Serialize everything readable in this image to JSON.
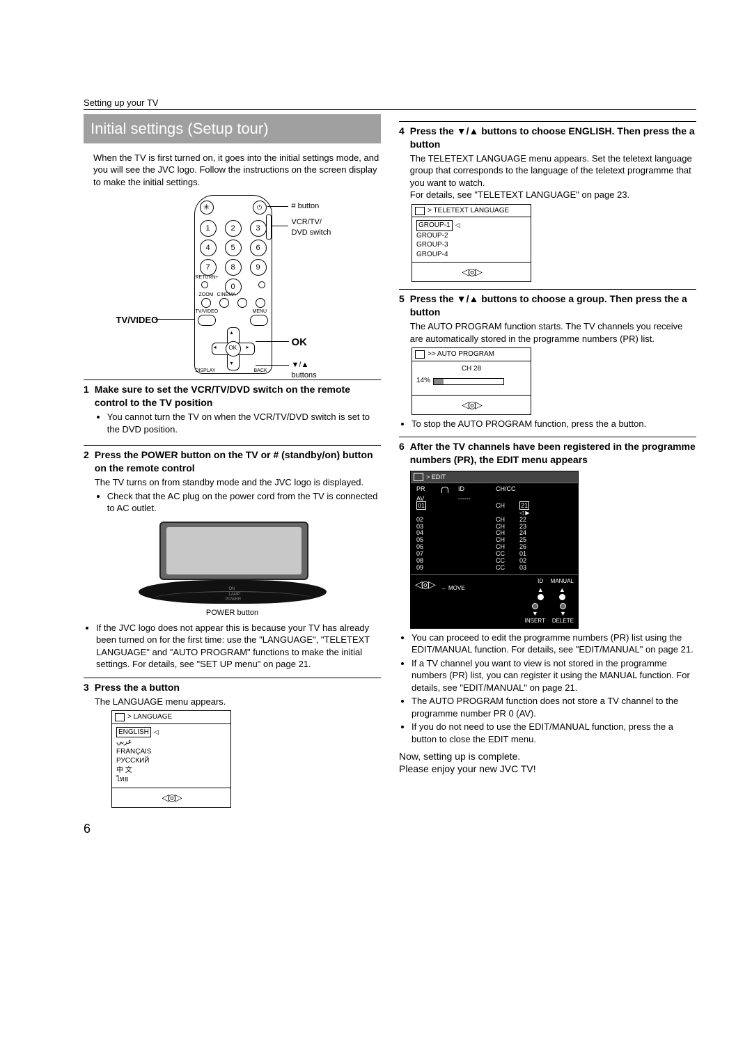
{
  "page_number": "6",
  "section_label": "Setting up your TV",
  "heading": "Initial settings (Setup tour)",
  "intro": "When the TV is first turned on, it goes into the initial settings mode, and you will see the JVC logo. Follow the instructions on the screen display to make the initial settings.",
  "remote": {
    "label_tvvideo": "TV/VIDEO",
    "label_ok": "OK",
    "callout_standby": "# button",
    "callout_switch": "VCR/TV/\nDVD switch",
    "callout_arrows": "▼/▲ buttons",
    "tiny_return": "RETURN+",
    "tiny_zoom": "ZOOM",
    "tiny_cinema": "CINEMA",
    "tiny_tvvideo": "TV/VIDEO",
    "tiny_menu": "MENU",
    "tiny_display": "DISPLAY",
    "tiny_back": "BACK",
    "ok_inner": "OK"
  },
  "steps_left": [
    {
      "num": "1",
      "title": "Make sure to set the VCR/TV/DVD switch on the remote control to the TV position",
      "bullets": [
        "You cannot turn the TV on when the VCR/TV/DVD switch is set to the DVD position."
      ]
    },
    {
      "num": "2",
      "title": "Press the POWER button on the TV or # (standby/on) button on the remote control",
      "text": "The TV turns on from standby mode and the JVC logo is displayed.",
      "bullets": [
        "Check that the AC plug on the power cord from the TV is connected to AC outlet."
      ]
    },
    {
      "num": "3",
      "title": "Press the a button",
      "text": "The LANGUAGE menu appears."
    }
  ],
  "tv_caption": "POWER button",
  "post_tv_bullets": [
    "If the JVC logo does not appear this is because your TV has already been turned on for the first time: use the \"LANGUAGE\", \"TELETEXT LANGUAGE\" and \"AUTO PROGRAM\" functions to make the initial settings. For details, see \"SET UP menu\" on page 21."
  ],
  "osd_language": {
    "title": "> LANGUAGE",
    "items": [
      "ENGLISH",
      "عربي",
      "FRANÇAIS",
      "РУССКИЙ",
      "中 文",
      "ไทย"
    ]
  },
  "steps_right": [
    {
      "num": "4",
      "title": "Press the ▼/▲ buttons to choose ENGLISH. Then press the a button",
      "text": "The TELETEXT LANGUAGE menu appears. Set the teletext language group that corresponds to the language of the teletext programme that you want to watch.\nFor details, see \"TELETEXT LANGUAGE\" on page 23."
    },
    {
      "num": "5",
      "title": "Press the ▼/▲ buttons to choose a group. Then press the a button",
      "text": "The AUTO PROGRAM function starts. The TV channels you receive are automatically stored in the programme numbers (PR) list."
    },
    {
      "num": "6",
      "title": "After the TV channels have been registered in the programme numbers (PR), the EDIT menu appears"
    }
  ],
  "osd_teletext": {
    "title": "> TELETEXT LANGUAGE",
    "items": [
      "GROUP-1",
      "GROUP-2",
      "GROUP-3",
      "GROUP-4"
    ]
  },
  "osd_autoprogram": {
    "title": ">> AUTO PROGRAM",
    "ch_label": "CH  28",
    "percent": "14%"
  },
  "post_autoprogram_bullets": [
    "To stop the AUTO PROGRAM function, press the a button."
  ],
  "osd_edit": {
    "title": "> EDIT",
    "col_pr": "PR",
    "col_lock": "🔒",
    "col_id": "ID",
    "col_chcc": "CH/CC",
    "rows": [
      {
        "pr": "AV",
        "id": "------",
        "cc": "",
        "ch": ""
      },
      {
        "pr": "01",
        "id": "",
        "cc": "CH",
        "ch": "21",
        "sel": true
      },
      {
        "pr": "02",
        "id": "",
        "cc": "CH",
        "ch": "22"
      },
      {
        "pr": "03",
        "id": "",
        "cc": "CH",
        "ch": "23"
      },
      {
        "pr": "04",
        "id": "",
        "cc": "CH",
        "ch": "24"
      },
      {
        "pr": "05",
        "id": "",
        "cc": "CH",
        "ch": "25"
      },
      {
        "pr": "06",
        "id": "",
        "cc": "CH",
        "ch": "26"
      },
      {
        "pr": "07",
        "id": "",
        "cc": "CC",
        "ch": "01"
      },
      {
        "pr": "08",
        "id": "",
        "cc": "CC",
        "ch": "02"
      },
      {
        "pr": "09",
        "id": "",
        "cc": "CC",
        "ch": "03"
      }
    ],
    "footer_move": "MOVE",
    "footer_id": "ID",
    "footer_manual": "MANUAL",
    "footer_insert": "INSERT",
    "footer_delete": "DELETE"
  },
  "post_edit_bullets": [
    "You can proceed to edit the programme numbers (PR) list using the EDIT/MANUAL function. For details, see \"EDIT/MANUAL\" on page 21.",
    "If a TV channel you want to view is not stored in the programme numbers (PR) list, you can register it using the MANUAL function. For details, see \"EDIT/MANUAL\" on page 21.",
    "The AUTO PROGRAM function does not store a TV channel to the programme number PR 0 (AV).",
    "If you do not need to use the EDIT/MANUAL function, press the a button to close the EDIT menu."
  ],
  "closing1": "Now, setting up is complete.",
  "closing2": "Please enjoy your new JVC TV!",
  "osd_dpad": "◁◎▷"
}
